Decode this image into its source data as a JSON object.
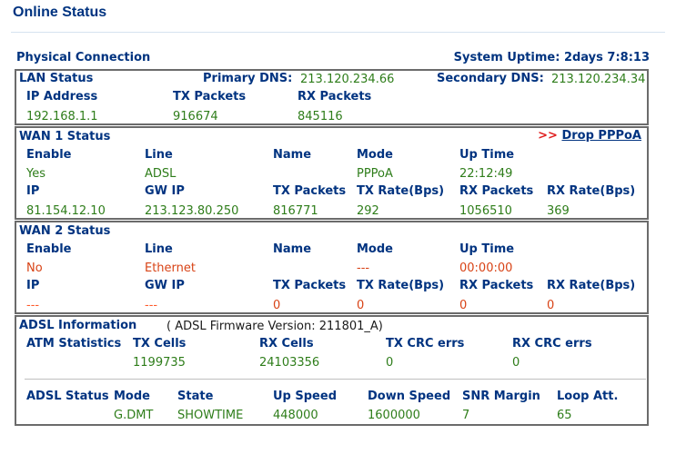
{
  "page": {
    "title": "Online Status"
  },
  "physical": {
    "label": "Physical Connection",
    "uptime_label": "System Uptime:",
    "uptime_value": "2days 7:8:13"
  },
  "lan": {
    "title": "LAN Status",
    "primary_dns_label": "Primary DNS:",
    "primary_dns": "213.120.234.66",
    "secondary_dns_label": "Secondary DNS:",
    "secondary_dns": "213.120.234.34",
    "headers": {
      "ip": "IP Address",
      "tx": "TX Packets",
      "rx": "RX Packets"
    },
    "values": {
      "ip": "192.168.1.1",
      "tx": "916674",
      "rx": "845116"
    }
  },
  "wan1": {
    "title": "WAN 1 Status",
    "drop_arrows": ">>",
    "drop_label": "Drop PPPoA",
    "headers1": {
      "enable": "Enable",
      "line": "Line",
      "name": "Name",
      "mode": "Mode",
      "uptime": "Up Time"
    },
    "values1": {
      "enable": "Yes",
      "line": "ADSL",
      "name": "",
      "mode": "PPPoA",
      "uptime": "22:12:49"
    },
    "headers2": {
      "ip": "IP",
      "gw": "GW IP",
      "tx": "TX Packets",
      "txrate": "TX Rate(Bps)",
      "rx": "RX Packets",
      "rxrate": "RX Rate(Bps)"
    },
    "values2": {
      "ip": "81.154.12.10",
      "gw": "213.123.80.250",
      "tx": "816771",
      "txrate": "292",
      "rx": "1056510",
      "rxrate": "369"
    }
  },
  "wan2": {
    "title": "WAN 2 Status",
    "headers1": {
      "enable": "Enable",
      "line": "Line",
      "name": "Name",
      "mode": "Mode",
      "uptime": "Up Time"
    },
    "values1": {
      "enable": "No",
      "line": "Ethernet",
      "name": "",
      "mode": "---",
      "uptime": "00:00:00"
    },
    "headers2": {
      "ip": "IP",
      "gw": "GW IP",
      "tx": "TX Packets",
      "txrate": "TX Rate(Bps)",
      "rx": "RX Packets",
      "rxrate": "RX Rate(Bps)"
    },
    "values2": {
      "ip": "---",
      "gw": "---",
      "tx": "0",
      "txrate": "0",
      "rx": "0",
      "rxrate": "0"
    }
  },
  "adsl": {
    "title": "ADSL Information",
    "firmware_text": "( ADSL Firmware Version:  211801_A)",
    "atm_label": "ATM Statistics",
    "atm_headers": {
      "tx_cells": "TX Cells",
      "rx_cells": "RX Cells",
      "tx_crc": "TX CRC errs",
      "rx_crc": "RX CRC errs"
    },
    "atm_values": {
      "tx_cells": "1199735",
      "rx_cells": "24103356",
      "tx_crc": "0",
      "rx_crc": "0"
    },
    "status_label": "ADSL Status",
    "status_headers": {
      "mode": "Mode",
      "state": "State",
      "up": "Up Speed",
      "down": "Down Speed",
      "snr": "SNR Margin",
      "loop": "Loop Att."
    },
    "status_values": {
      "mode": "G.DMT",
      "state": "SHOWTIME",
      "up": "448000",
      "down": "1600000",
      "snr": "7",
      "loop": "65"
    }
  },
  "colors": {
    "heading": "#003380",
    "value": "#2e7d1a",
    "inactive": "#d84316",
    "border": "#6b6b6b"
  }
}
